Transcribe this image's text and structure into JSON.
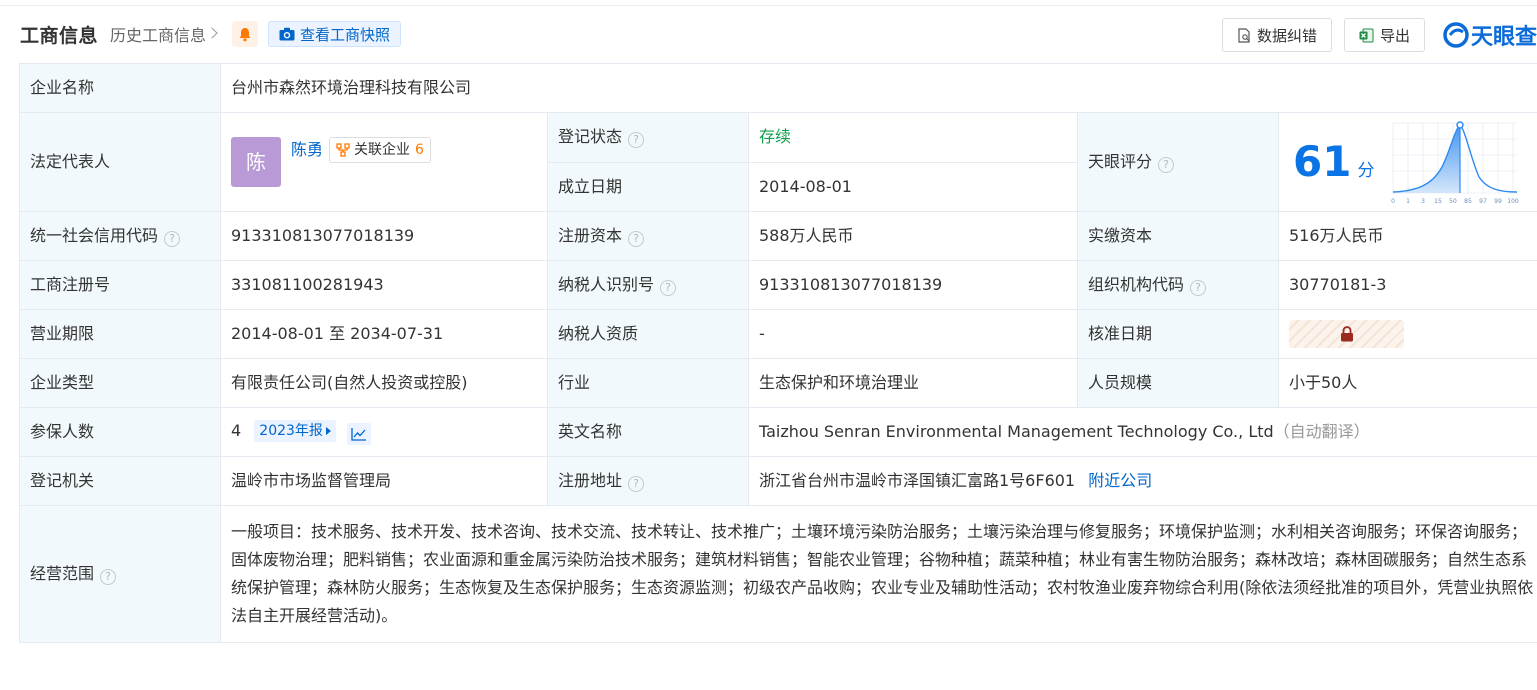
{
  "header": {
    "title": "工商信息",
    "history_link": "历史工商信息",
    "snapshot_button": "查看工商快照",
    "data_correction_button": "数据纠错",
    "export_button": "导出",
    "logo_text": "天眼查"
  },
  "company": {
    "name_label": "企业名称",
    "name": "台州市森然环境治理科技有限公司",
    "legal_rep_label": "法定代表人",
    "legal_rep_avatar": "陈",
    "legal_rep_name": "陈勇",
    "related_label": "关联企业",
    "related_count": "6",
    "status_label": "登记状态",
    "status": "存续",
    "found_label": "成立日期",
    "found_date": "2014-08-01",
    "score_label": "天眼评分",
    "score": "61",
    "score_unit": "分",
    "score_axis": [
      "0",
      "1",
      "3",
      "15",
      "50",
      "85",
      "97",
      "99",
      "100"
    ],
    "credit_label": "统一社会信用代码",
    "credit_code": "913310813077018139",
    "reg_capital_label": "注册资本",
    "reg_capital": "588万人民币",
    "paid_capital_label": "实缴资本",
    "paid_capital": "516万人民币",
    "biz_reg_label": "工商注册号",
    "biz_reg_no": "331081100281943",
    "taxpayer_label": "纳税人识别号",
    "taxpayer_id": "913310813077018139",
    "org_code_label": "组织机构代码",
    "org_code": "30770181-3",
    "term_label": "营业期限",
    "term": "2014-08-01 至 2034-07-31",
    "tax_qual_label": "纳税人资质",
    "tax_qual": "-",
    "approve_label": "核准日期",
    "type_label": "企业类型",
    "type": "有限责任公司(自然人投资或控股)",
    "industry_label": "行业",
    "industry": "生态保护和环境治理业",
    "staff_label": "人员规模",
    "staff": "小于50人",
    "insured_label": "参保人数",
    "insured": "4",
    "report_tag": "2023年报",
    "en_name_label": "英文名称",
    "en_name": "Taizhou Senran Environmental Management Technology Co., Ltd",
    "en_name_note": "（自动翻译）",
    "authority_label": "登记机关",
    "authority": "温岭市市场监督管理局",
    "address_label": "注册地址",
    "address": "浙江省台州市温岭市泽国镇汇富路1号6F601",
    "nearby_link": "附近公司",
    "scope_label": "经营范围",
    "scope": "一般项目：技术服务、技术开发、技术咨询、技术交流、技术转让、技术推广；土壤环境污染防治服务；土壤污染治理与修复服务；环境保护监测；水利相关咨询服务；环保咨询服务；固体废物治理；肥料销售；农业面源和重金属污染防治技术服务；建筑材料销售；智能农业管理；谷物种植；蔬菜种植；林业有害生物防治服务；森林改培；森林固碳服务；自然生态系统保护管理；森林防火服务；生态恢复及生态保护服务；生态资源监测；初级农产品收购；农业专业及辅助性活动；农村牧渔业废弃物综合利用(除依法须经批准的项目外，凭营业执照依法自主开展经营活动)。"
  },
  "colors": {
    "label_bg": "#f2f9fc",
    "border": "#e4eaf0",
    "link": "#0066cc",
    "status_green": "#10a04b",
    "score_blue": "#0a74e6"
  },
  "icons": [
    "bell-icon",
    "camera-icon",
    "document-icon",
    "excel-icon",
    "tianyancha-logo-icon",
    "help-icon",
    "related-company-icon",
    "lock-icon",
    "trend-chart-icon"
  ]
}
